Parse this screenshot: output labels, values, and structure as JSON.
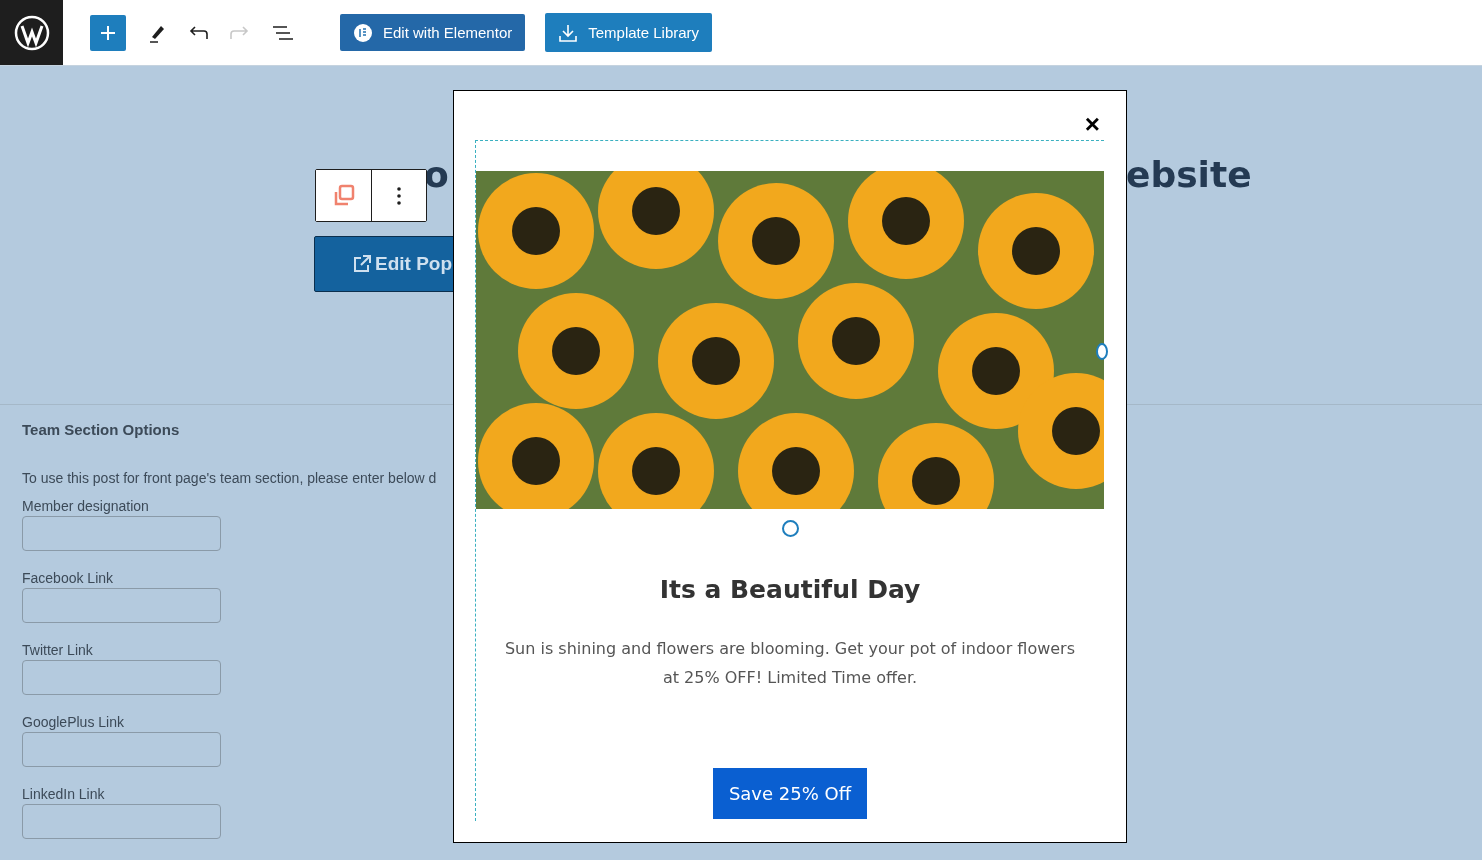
{
  "toolbar": {
    "edit_elementor": "Edit with Elementor",
    "template_library": "Template Library",
    "redo_disabled": true
  },
  "page": {
    "heading_fragments": [
      "o",
      "ebsite"
    ],
    "edit_popup_button": "Edit Pop"
  },
  "team_section": {
    "title": "Team Section Options",
    "description": "To use this post for front page's team section, please enter below d",
    "fields": [
      {
        "label": "Member designation"
      },
      {
        "label": "Facebook Link"
      },
      {
        "label": "Twitter Link"
      },
      {
        "label": "GooglePlus Link"
      },
      {
        "label": "LinkedIn Link"
      }
    ]
  },
  "popup": {
    "close": "×",
    "heading": "Its a Beautiful Day",
    "text": "Sun is shining and flowers are blooming. Get your pot of indoor flowers at 25% OFF! Limited Time offer.",
    "button": "Save 25% Off"
  }
}
